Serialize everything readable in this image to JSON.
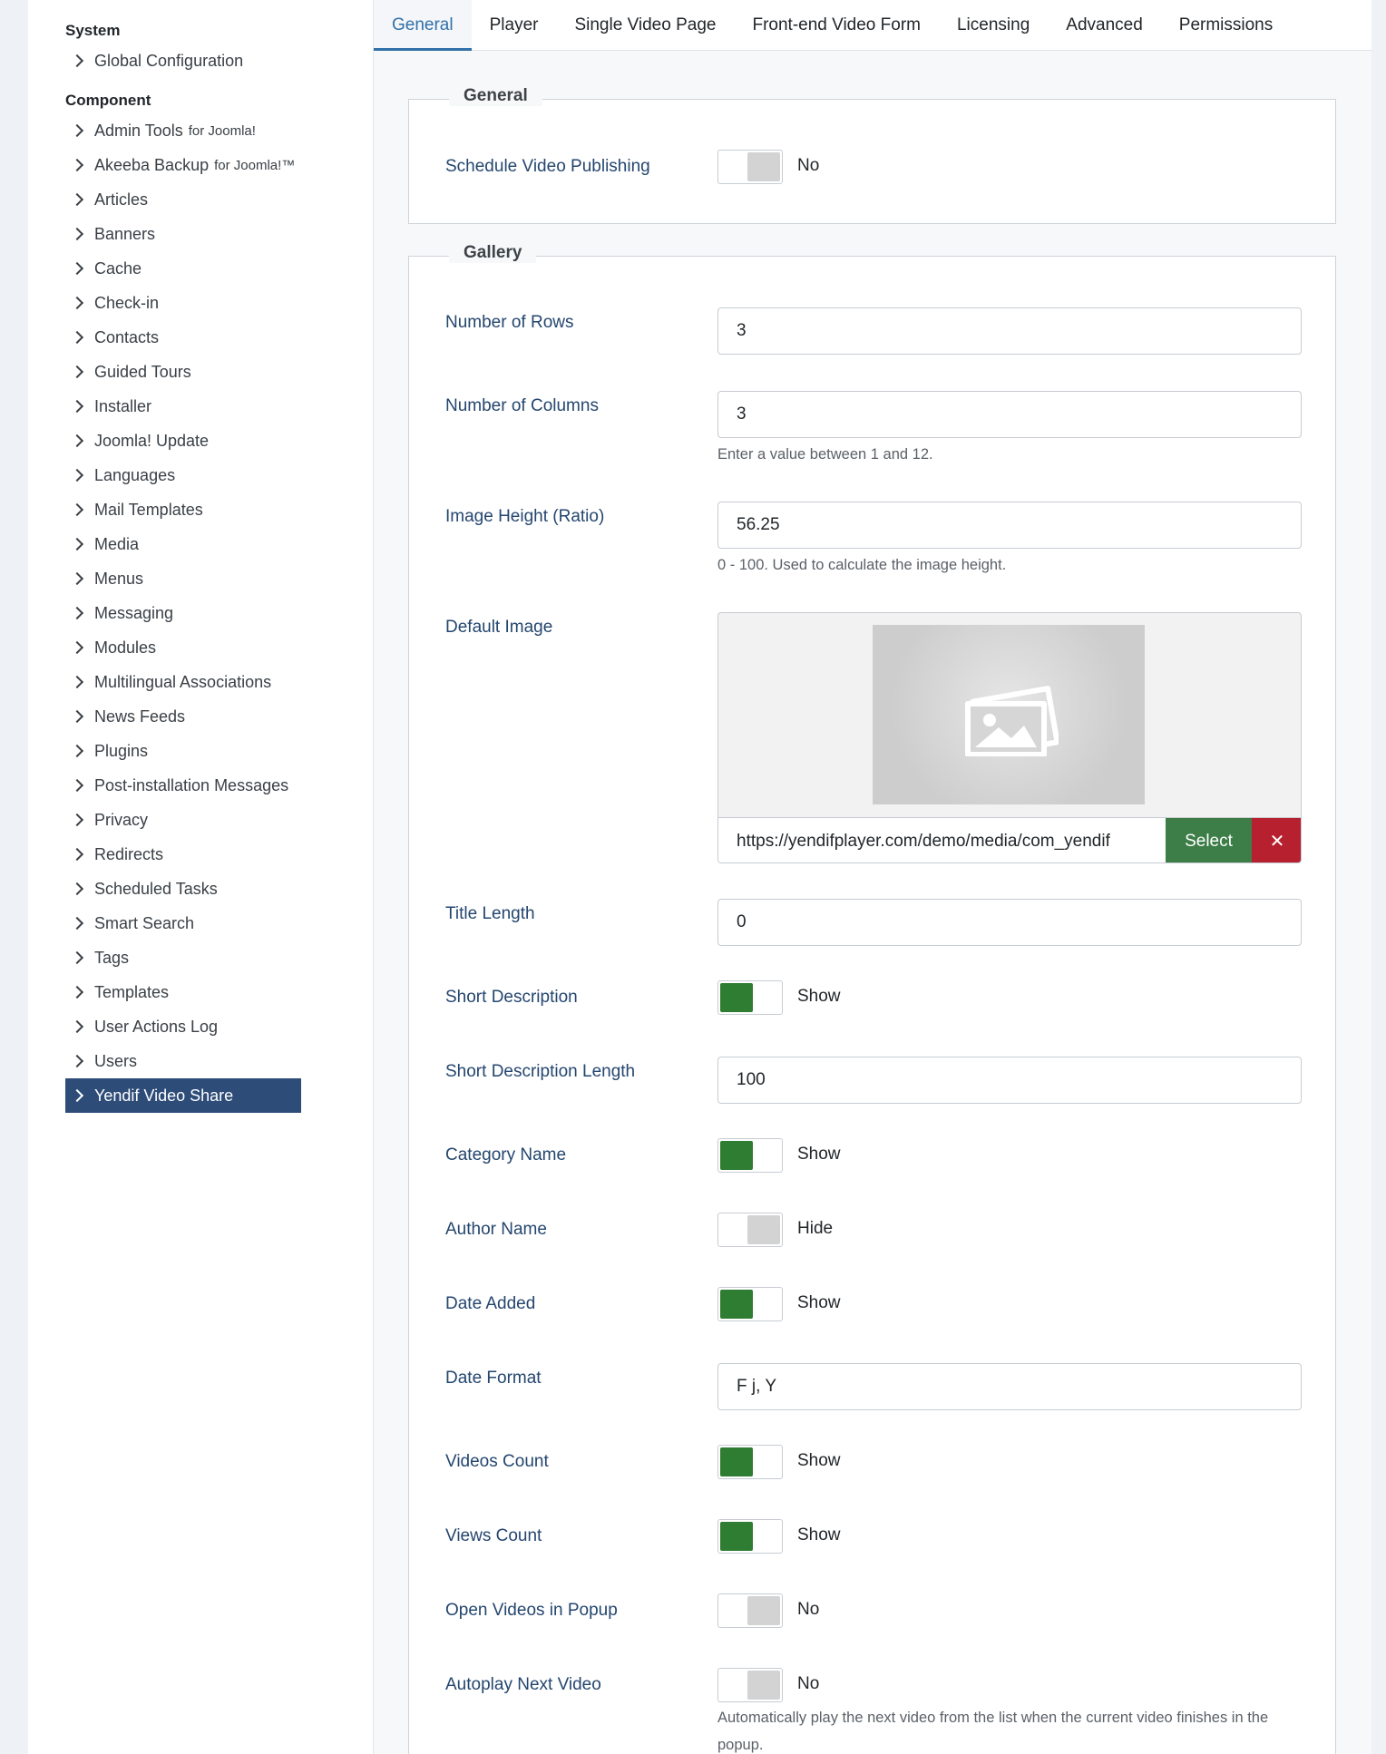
{
  "sidebar": {
    "system_heading": "System",
    "system_items": [
      {
        "label": "Global Configuration"
      }
    ],
    "component_heading": "Component",
    "component_items": [
      {
        "label": "Admin Tools",
        "suffix": "for Joomla!"
      },
      {
        "label": "Akeeba Backup",
        "suffix": "for Joomla!™"
      },
      {
        "label": "Articles"
      },
      {
        "label": "Banners"
      },
      {
        "label": "Cache"
      },
      {
        "label": "Check-in"
      },
      {
        "label": "Contacts"
      },
      {
        "label": "Guided Tours"
      },
      {
        "label": "Installer"
      },
      {
        "label": "Joomla! Update"
      },
      {
        "label": "Languages"
      },
      {
        "label": "Mail Templates"
      },
      {
        "label": "Media"
      },
      {
        "label": "Menus"
      },
      {
        "label": "Messaging"
      },
      {
        "label": "Modules"
      },
      {
        "label": "Multilingual Associations"
      },
      {
        "label": "News Feeds"
      },
      {
        "label": "Plugins"
      },
      {
        "label": "Post-installation Messages"
      },
      {
        "label": "Privacy"
      },
      {
        "label": "Redirects"
      },
      {
        "label": "Scheduled Tasks"
      },
      {
        "label": "Smart Search"
      },
      {
        "label": "Tags"
      },
      {
        "label": "Templates"
      },
      {
        "label": "User Actions Log"
      },
      {
        "label": "Users"
      },
      {
        "label": "Yendif Video Share",
        "active": true
      }
    ]
  },
  "tabs": [
    "General",
    "Player",
    "Single Video Page",
    "Front-end Video Form",
    "Licensing",
    "Advanced",
    "Permissions"
  ],
  "active_tab": "General",
  "general": {
    "legend": "General",
    "schedule_label": "Schedule Video Publishing",
    "schedule_state": "No"
  },
  "gallery": {
    "legend": "Gallery",
    "rows_label": "Number of Rows",
    "rows_value": "3",
    "columns_label": "Number of Columns",
    "columns_value": "3",
    "columns_help": "Enter a value between 1 and 12.",
    "image_height_label": "Image Height (Ratio)",
    "image_height_value": "56.25",
    "image_height_help": "0 - 100. Used to calculate the image height.",
    "default_image_label": "Default Image",
    "default_image_url": "https://yendifplayer.com/demo/media/com_yendif",
    "select_button": "Select",
    "clear_button": "✕",
    "title_length_label": "Title Length",
    "title_length_value": "0",
    "short_desc_label": "Short Description",
    "short_desc_state": "Show",
    "short_desc_length_label": "Short Description Length",
    "short_desc_length_value": "100",
    "category_name_label": "Category Name",
    "category_name_state": "Show",
    "author_name_label": "Author Name",
    "author_name_state": "Hide",
    "date_added_label": "Date Added",
    "date_added_state": "Show",
    "date_format_label": "Date Format",
    "date_format_value": "F j, Y",
    "videos_count_label": "Videos Count",
    "videos_count_state": "Show",
    "views_count_label": "Views Count",
    "views_count_state": "Show",
    "popup_label": "Open Videos in Popup",
    "popup_state": "No",
    "autoplay_label": "Autoplay Next Video",
    "autoplay_state": "No",
    "autoplay_help": "Automatically play the next video from the list when the current video finishes in the popup."
  },
  "colors": {
    "accent": "#3071a9",
    "active_sidebar": "#2d4c78",
    "switch_on": "#2e7d32",
    "select_button": "#3d7d47",
    "clear_button": "#b7202e"
  }
}
